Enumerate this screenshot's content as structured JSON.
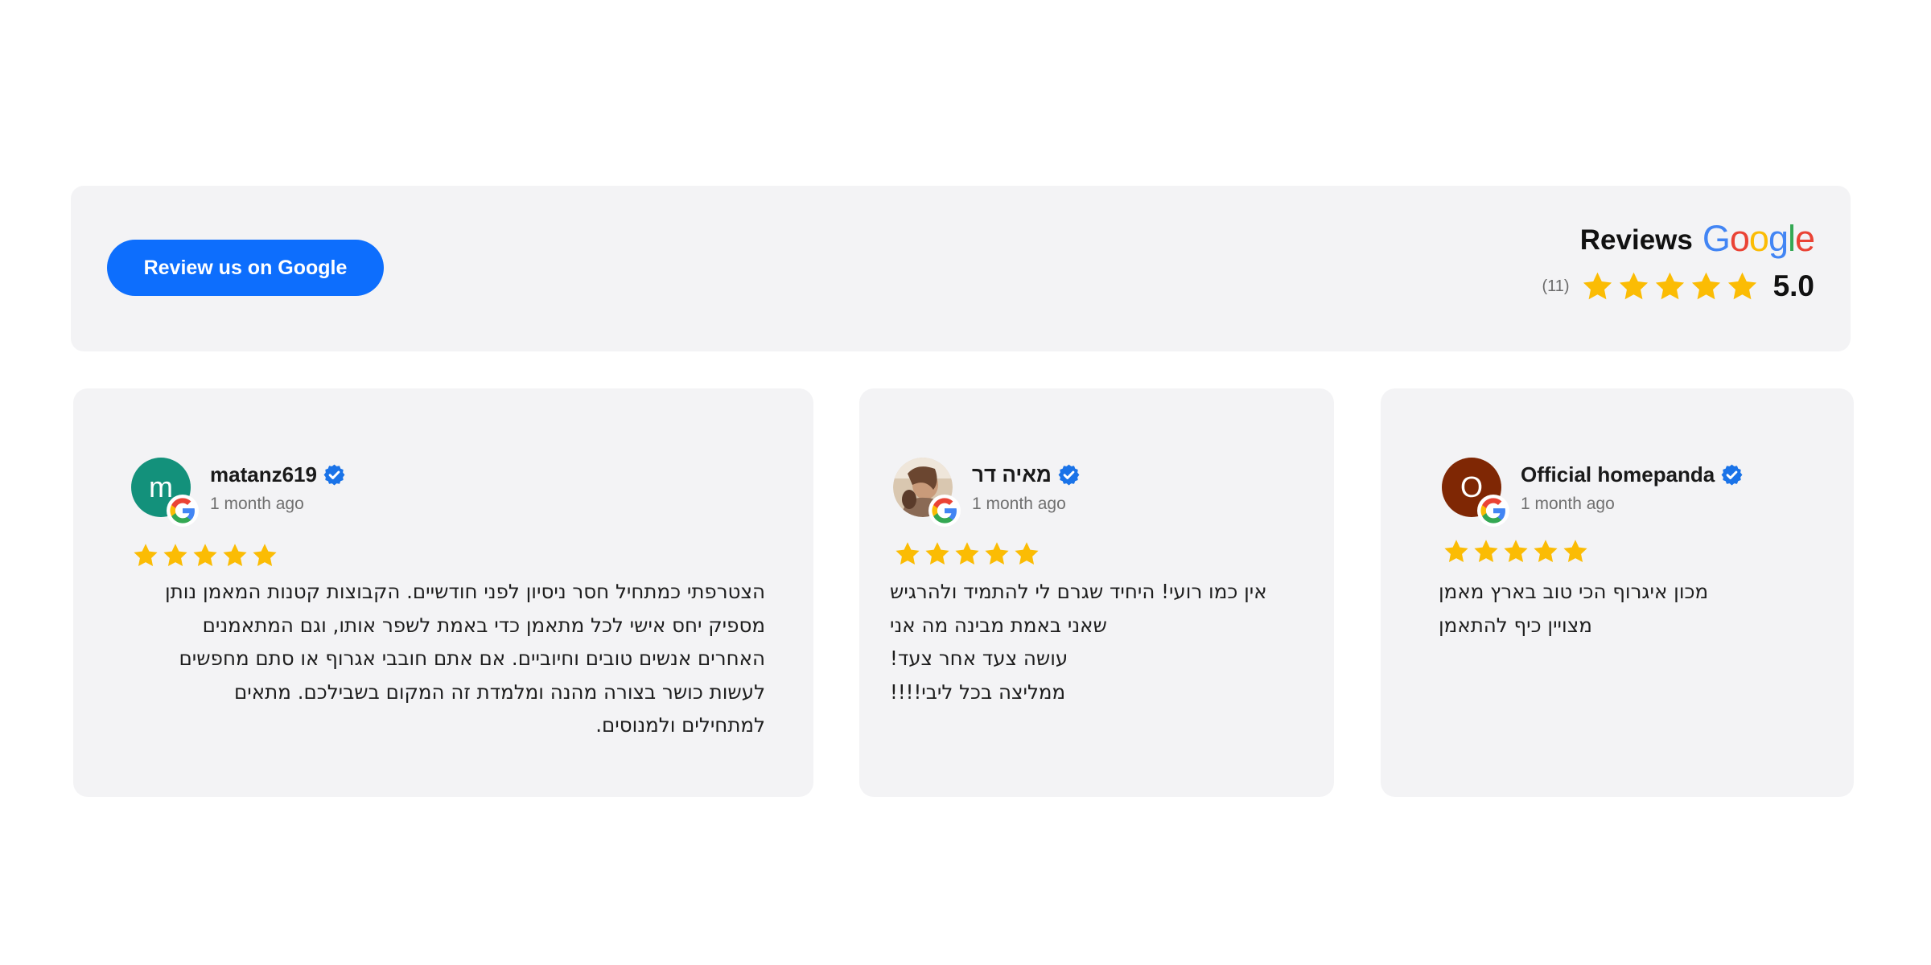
{
  "header": {
    "button_label": "Review us on Google",
    "title": "Reviews",
    "google_wordmark": [
      "G",
      "o",
      "o",
      "g",
      "l",
      "e"
    ],
    "google_wordmark_colors": [
      "#4285F4",
      "#EA4335",
      "#FBBC05",
      "#4285F4",
      "#34A853",
      "#EA4335"
    ],
    "review_count": "(11)",
    "rating": "5.0",
    "star_count": 5
  },
  "colors": {
    "accent_button": "#0d6efd",
    "star": "#FBBC04",
    "verified": "#1a73e8",
    "panel_background": "#f3f3f5"
  },
  "reviews": [
    {
      "name": "matanz619",
      "avatar_letter": "m",
      "avatar_color": "#13917b",
      "date": "1 month ago",
      "stars": 5,
      "text_lines": [
        "הצטרפתי כמתחיל חסר ניסיון לפני חודשיים. הקבוצות קטנות המאמן נותן",
        "מספיק יחס אישי לכל מתאמן כדי באמת לשפר אותו, וגם המתאמנים",
        "האחרים אנשים טובים וחיוביים. אם אתם חובבי אגרוף או סתם מחפשים",
        "לעשות כושר בצורה מהנה ומלמדת זה המקום בשבילכם. מתאים",
        "למתחילים ולמנוסים."
      ]
    },
    {
      "name": "מאיה דר",
      "avatar_letter": "",
      "avatar_color": "#b08a6a",
      "date": "1 month ago",
      "stars": 5,
      "text_lines": [
        "אין כמו רועי! היחיד שגרם לי להתמיד ולהרגיש",
        "שאני באמת מבינה מה אני",
        "עושה צעד אחר צעד!",
        "ממליצה בכל ליבי!!!!"
      ]
    },
    {
      "name": "Official homepanda",
      "avatar_letter": "O",
      "avatar_color": "#7f2704",
      "date": "1 month ago",
      "stars": 5,
      "text_lines": [
        "מכון איגרוף הכי טוב בארץ מאמן",
        "מצויין כיף להתאמן"
      ]
    }
  ],
  "icons": {
    "star": "star-icon",
    "verified": "verified-badge-icon",
    "google": "google-g-icon"
  }
}
